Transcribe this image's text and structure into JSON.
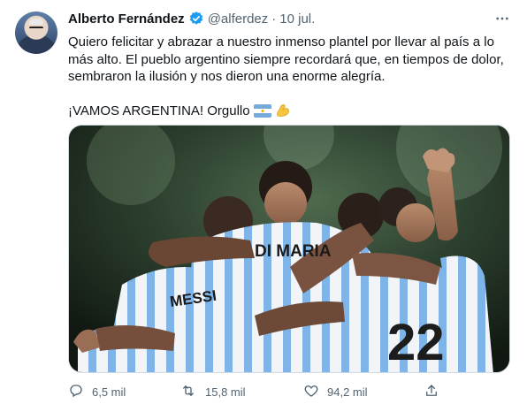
{
  "tweet": {
    "author_name": "Alberto Fernández",
    "handle": "@alferdez",
    "separator": "·",
    "date": "10 jul.",
    "text_lines": [
      "Quiero felicitar y abrazar a nuestro inmenso plantel por llevar al país a lo",
      "más alto. El pueblo argentino siempre recordará que, en tiempos de dolor,",
      "sembraron la ilusión y nos dieron una enorme alegría."
    ],
    "text_line2": "¡VAMOS ARGENTINA! Orgullo",
    "emojis": [
      "argentina-flag-icon",
      "flexed-biceps-icon"
    ],
    "media": {
      "jersey_names": [
        "DI MARIA",
        "MESSI"
      ],
      "jersey_number": "22"
    }
  },
  "actions": {
    "reply_count": "6,5 mil",
    "retweet_count": "15,8 mil",
    "like_count": "94,2 mil"
  },
  "colors": {
    "text": "#0f1419",
    "secondary": "#536471",
    "verified": "#1d9bf0",
    "jersey_blue": "#7fb4e8"
  }
}
